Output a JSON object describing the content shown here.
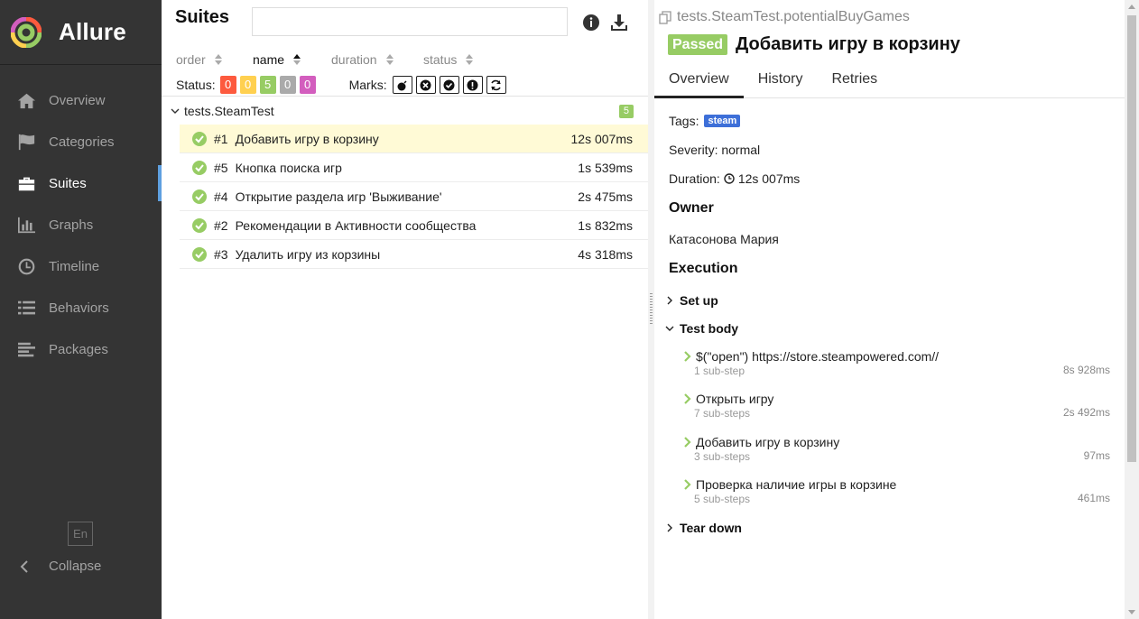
{
  "sidebar": {
    "brand": "Allure",
    "items": [
      {
        "label": "Overview",
        "icon": "home-icon"
      },
      {
        "label": "Categories",
        "icon": "flag-icon"
      },
      {
        "label": "Suites",
        "icon": "briefcase-icon"
      },
      {
        "label": "Graphs",
        "icon": "bar-chart-icon"
      },
      {
        "label": "Timeline",
        "icon": "clock-icon"
      },
      {
        "label": "Behaviors",
        "icon": "list-icon"
      },
      {
        "label": "Packages",
        "icon": "align-left-icon"
      }
    ],
    "active": "Suites",
    "lang": "En",
    "collapse": "Collapse"
  },
  "suites": {
    "title": "Suites",
    "search_value": "",
    "sorters": [
      {
        "label": "order"
      },
      {
        "label": "name"
      },
      {
        "label": "duration"
      },
      {
        "label": "status"
      }
    ],
    "active_sorter": "name",
    "status_label": "Status:",
    "status_counts": [
      {
        "value": "0",
        "color": "#fd5a3e"
      },
      {
        "value": "0",
        "color": "#ffd050"
      },
      {
        "value": "5",
        "color": "#97cc64"
      },
      {
        "value": "0",
        "color": "#aaaaaa"
      },
      {
        "value": "0",
        "color": "#d35ebe"
      }
    ],
    "marks_label": "Marks:",
    "group": {
      "name": "tests.SteamTest",
      "count": "5",
      "tests": [
        {
          "num": "#1",
          "name": "Добавить игру в корзину",
          "duration": "12s 007ms",
          "selected": true
        },
        {
          "num": "#5",
          "name": "Кнопка поиска игр",
          "duration": "1s 539ms"
        },
        {
          "num": "#4",
          "name": "Открытие раздела игр 'Выживание'",
          "duration": "2s 475ms"
        },
        {
          "num": "#2",
          "name": "Рекомендации в Активности сообщества",
          "duration": "1s 832ms"
        },
        {
          "num": "#3",
          "name": "Удалить игру из корзины",
          "duration": "4s 318ms"
        }
      ]
    }
  },
  "detail": {
    "breadcrumb": "tests.SteamTest.potentialBuyGames",
    "status": "Passed",
    "title": "Добавить игру в корзину",
    "tabs": [
      "Overview",
      "History",
      "Retries"
    ],
    "tags_label": "Tags:",
    "tag": "steam",
    "severity": "Severity: normal",
    "duration_label": "Duration:",
    "duration": "12s 007ms",
    "owner_title": "Owner",
    "owner": "Катасонова Мария",
    "execution_title": "Execution",
    "setup": "Set up",
    "test_body": "Test body",
    "teardown": "Tear down",
    "steps": [
      {
        "name": "$(\"open\") https://store.steampowered.com//",
        "sub": "1 sub-step",
        "duration": "8s 928ms"
      },
      {
        "name": "Открыть игру",
        "sub": "7 sub-steps",
        "duration": "2s 492ms"
      },
      {
        "name": "Добавить игру в корзину",
        "sub": "3 sub-steps",
        "duration": "97ms"
      },
      {
        "name": "Проверка наличие игры в корзине",
        "sub": "5 sub-steps",
        "duration": "461ms"
      }
    ]
  },
  "colors": {
    "passed": "#97cc64",
    "sidebar": "#343434",
    "accent": "#5ea0e0",
    "tag": "#3d6fd8",
    "selected_row": "#fffad6"
  }
}
